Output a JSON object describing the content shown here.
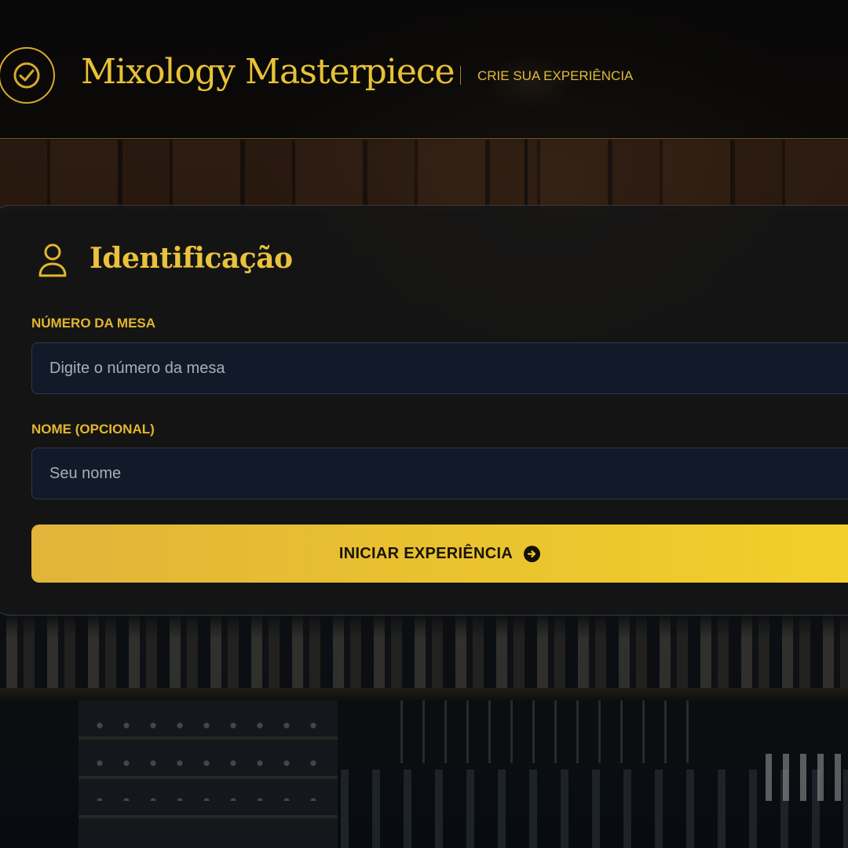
{
  "header": {
    "brand_title": "Mixology Masterpiece",
    "tagline": "CRIE SUA EXPERIÊNCIA",
    "logo_icon": "check-circle-icon"
  },
  "card": {
    "title": "Identificação",
    "title_icon": "user-icon",
    "fields": {
      "table_number": {
        "label": "NÚMERO DA MESA",
        "value": "",
        "placeholder": "Digite o número da mesa"
      },
      "name": {
        "label": "NOME (OPCIONAL)",
        "value": "",
        "placeholder": "Seu nome"
      }
    },
    "submit": {
      "label": "INICIAR EXPERIÊNCIA",
      "icon": "arrow-right-circle-icon"
    }
  },
  "colors": {
    "accent_gold": "#e9c235",
    "button_gold_start": "#e1b43a",
    "button_gold_end": "#f2d02a",
    "input_background": "#121a2a",
    "card_background": "#161616"
  }
}
